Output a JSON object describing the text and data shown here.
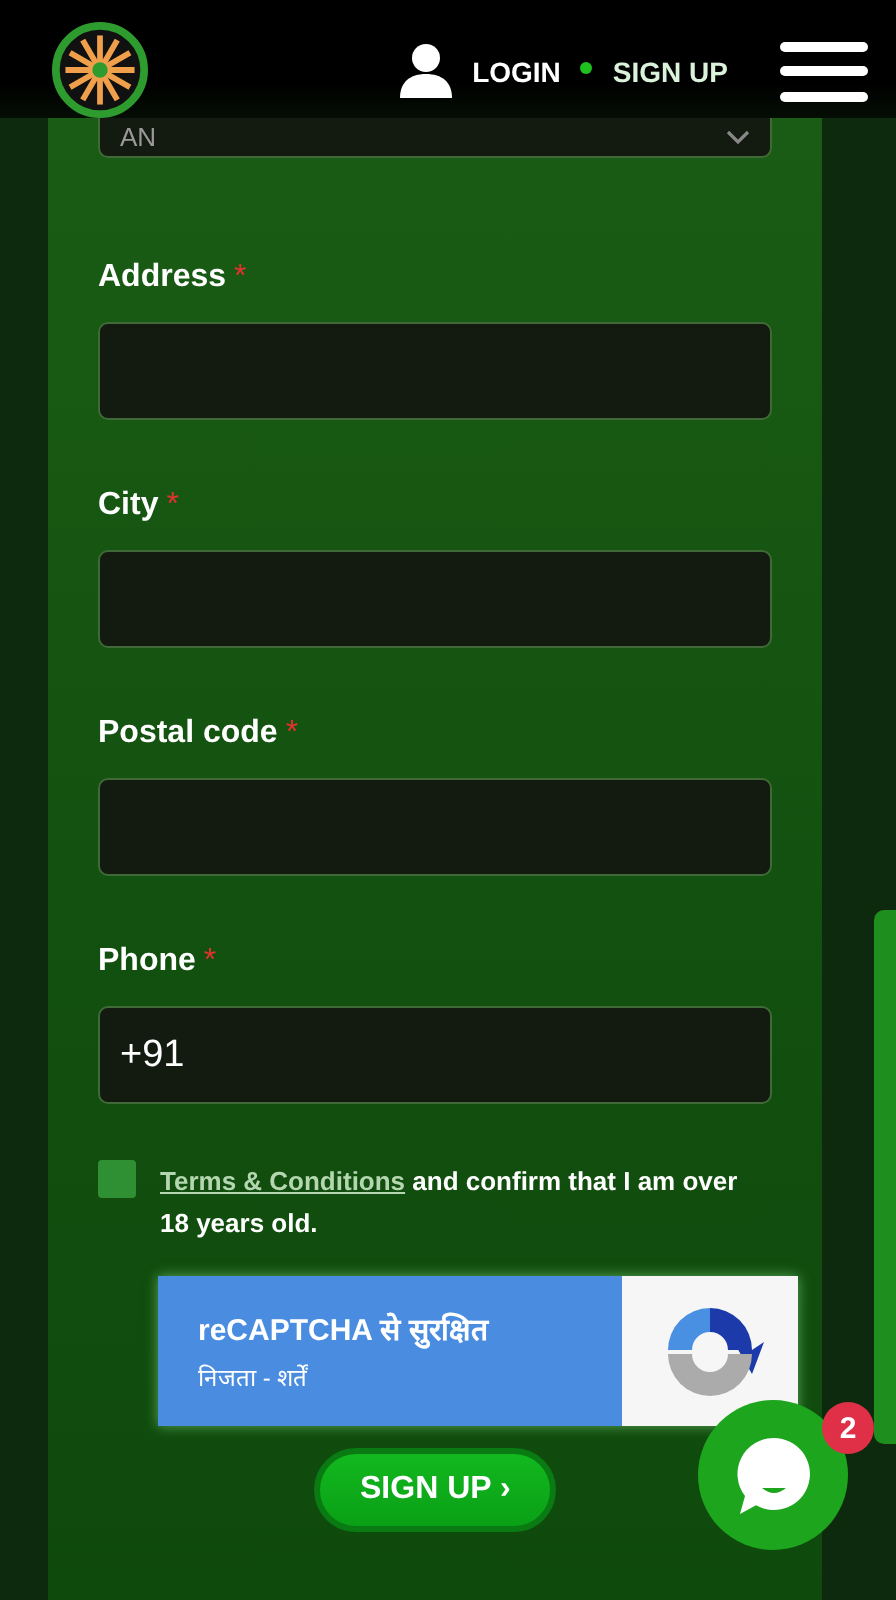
{
  "header": {
    "login": "LOGIN",
    "signup": "SIGN UP"
  },
  "select": {
    "value": "AN"
  },
  "fields": [
    {
      "label": "Address",
      "required_mark": "*"
    },
    {
      "label": "City",
      "required_mark": "*"
    },
    {
      "label": "Postal code",
      "required_mark": "*"
    },
    {
      "label": "Phone",
      "required_mark": "*",
      "value": "+91"
    }
  ],
  "terms": {
    "checked": false,
    "link": "Terms & Conditions",
    "text": "and confirm that I am over 18 years old."
  },
  "captcha": {
    "title": "reCAPTCHA से सुरक्षित",
    "links": "निजता - शर्तें"
  },
  "submit": "SIGN UP",
  "submit_arrow": "›",
  "chat": {
    "badge": "2"
  }
}
